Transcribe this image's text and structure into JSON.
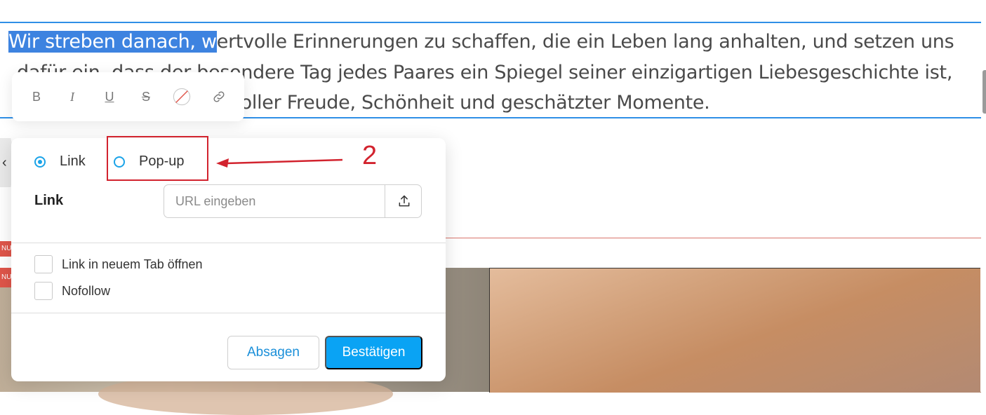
{
  "paragraph": {
    "line1_selected": "Wir streben danach, w",
    "line1_rest": "ertvolle Erinnerungen zu schaffen, die ein Leben lang anhalten, und setzen uns",
    "line2": "dafür ein, dass der besondere Tag jedes Paares ein Spiegel seiner einzigartigen Liebesgeschichte ist,",
    "line3": "voller Freude, Schönheit und geschätzter Momente."
  },
  "badges": [
    "NU",
    "NU"
  ],
  "toolbar": {
    "bold": "B",
    "italic": "I",
    "underline": "U",
    "strikethrough": "S"
  },
  "dialog": {
    "back": "‹",
    "radio_link": "Link",
    "radio_popup": "Pop-up",
    "link_label": "Link",
    "url_placeholder": "URL eingeben",
    "url_value": "",
    "new_tab_label": "Link in neuem Tab öffnen",
    "nofollow_label": "Nofollow",
    "cancel_label": "Absagen",
    "confirm_label": "Bestätigen",
    "selected_type": "Link"
  },
  "annotation": {
    "step_number": "2",
    "color": "#d2232e"
  },
  "colors": {
    "accent": "#0aa3f4",
    "selection": "#3d83e0",
    "edge_line": "#2f8fe6"
  }
}
